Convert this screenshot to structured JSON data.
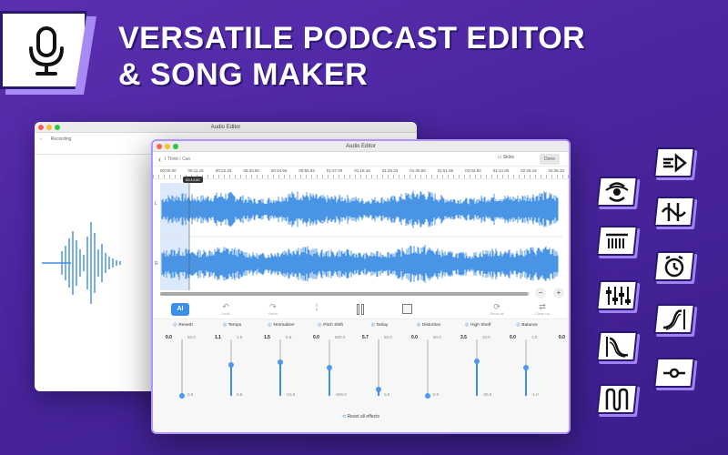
{
  "headline": {
    "line1": "VERSATILE PODCAST EDITOR",
    "line2": "& SONG MAKER"
  },
  "logo_icon": "microphone-icon",
  "back_window": {
    "title": "Audio Editor",
    "nav_label": "Recording"
  },
  "front_window": {
    "title": "Audio Editor",
    "breadcrumb": "I Think I Can",
    "skins_label": "Skins",
    "done_label": "Done",
    "ruler_times": [
      "00:00.00",
      "00:11.16",
      "00:22.33",
      "00:33.50",
      "00:44.66",
      "00:55.83",
      "01:07.00",
      "01:18.16",
      "01:29.33",
      "01:40.50",
      "01:51.66",
      "02:02.83",
      "02:14.00",
      "02:25.16",
      "02:36.33"
    ],
    "playhead_time": "00:14.80",
    "channels": [
      "L",
      "R"
    ],
    "toolbar": {
      "ai_label": "AI",
      "undo_label": "Undo",
      "redo_label": "Redo",
      "show_all_label": "Show all",
      "clean_up_label": "Clean up"
    },
    "effects": [
      {
        "name": "Reverb",
        "icon": "reverb-icon",
        "value": "0.0",
        "max": "50.0",
        "min": "0.0",
        "level": 0.0
      },
      {
        "name": "Tempo",
        "icon": "tempo-icon",
        "value": "1.1",
        "max": "1.5",
        "min": "0.5",
        "level": 0.55
      },
      {
        "name": "Normalizer",
        "icon": "normalizer-icon",
        "value": "1.5",
        "max": "0.5",
        "min": "-10.0",
        "level": 0.6
      },
      {
        "name": "Pitch Shift",
        "icon": "pitch-shift-icon",
        "value": "0.0",
        "max": "600.0",
        "min": "-600.0",
        "level": 0.5
      },
      {
        "name": "Delay",
        "icon": "delay-icon",
        "value": "5.7",
        "max": "50.0",
        "min": "0.0",
        "level": 0.12
      },
      {
        "name": "Distortion",
        "icon": "distortion-icon",
        "value": "0.0",
        "max": "50.0",
        "min": "0.0",
        "level": 0.0
      },
      {
        "name": "High Shelf",
        "icon": "high-shelf-icon",
        "value": "3.5",
        "max": "15.0",
        "min": "-30.0",
        "level": 0.62
      },
      {
        "name": "Balance",
        "icon": "balance-icon",
        "value": "0.0",
        "max": "1.0",
        "min": "-1.0",
        "level": 0.5
      },
      {
        "name": "Lo",
        "icon": "low-icon",
        "value": "0.0",
        "max": "",
        "min": "",
        "level": 0.5
      }
    ],
    "reset_label": "Reset all effects"
  },
  "feature_icons": [
    "reverb-feature-icon",
    "speed-feature-icon",
    "normalizer-feature-icon",
    "pitch-feature-icon",
    "equalizer-feature-icon",
    "timer-feature-icon",
    "fade-out-feature-icon",
    "fade-in-feature-icon",
    "balance-feature-icon",
    "mix-feature-icon"
  ],
  "colors": {
    "background": "#4a25a0",
    "accent": "#3d8ee8",
    "tile_border": "#2a176f",
    "tile_shadow": "#9f83f2"
  }
}
